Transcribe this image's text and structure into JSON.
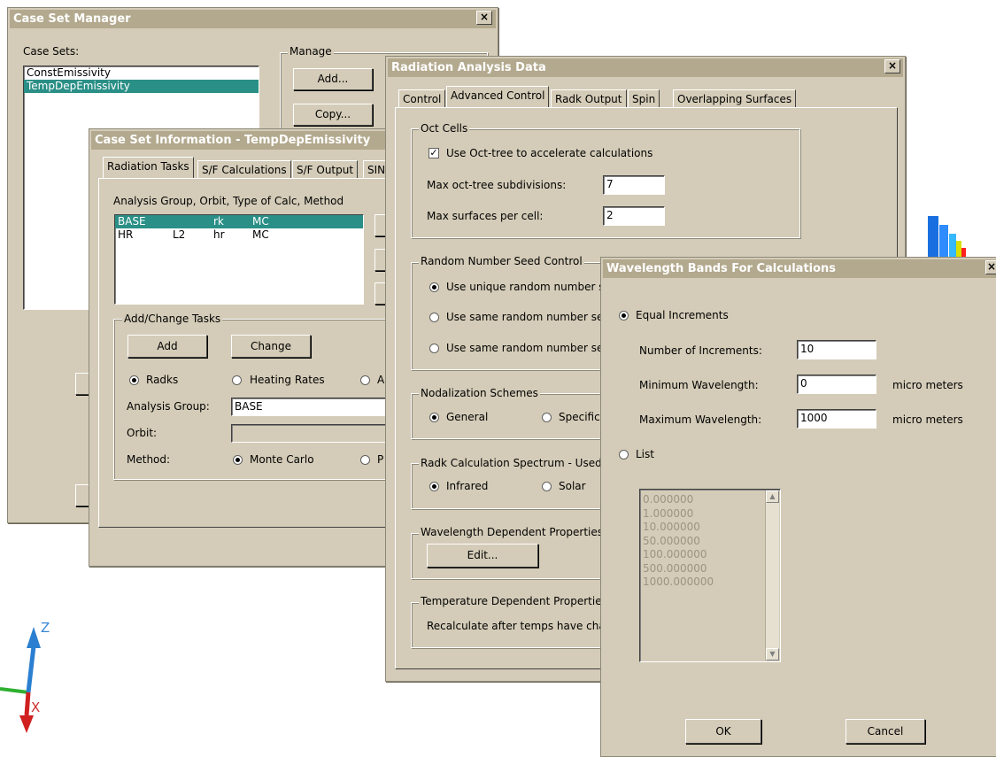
{
  "case_set_manager": {
    "title": "Case Set Manager",
    "close": "×",
    "case_sets_label": "Case Sets:",
    "case_sets": [
      "ConstEmissivity",
      "TempDepEmissivity"
    ],
    "selected_index": 1,
    "manage_label": "Manage",
    "add_button": "Add...",
    "copy_button": "Copy..."
  },
  "case_set_info": {
    "title": "Case Set Information - TempDepEmissivity",
    "tabs": [
      "Radiation Tasks",
      "S/F Calculations",
      "S/F Output",
      "SIN"
    ],
    "list_header": "Analysis Group, Orbit, Type of Calc, Method",
    "rows": [
      {
        "group": "BASE",
        "orbit": "",
        "calc": "rk",
        "method": "MC"
      },
      {
        "group": "HR",
        "orbit": "L2",
        "calc": "hr",
        "method": "MC"
      }
    ],
    "add_change_label": "Add/Change Tasks",
    "add_button": "Add",
    "change_button": "Change",
    "radio_radks": "Radks",
    "radio_heating": "Heating Rates",
    "radio_a": "A",
    "analysis_group_label": "Analysis Group:",
    "analysis_group_value": "BASE",
    "orbit_label": "Orbit:",
    "method_label": "Method:",
    "method_monte_carlo": "Monte Carlo",
    "method_p": "P"
  },
  "radiation_analysis": {
    "title": "Radiation Analysis Data",
    "close": "×",
    "tabs": [
      "Control",
      "Advanced Control",
      "Radk Output",
      "Spin",
      "Overlapping Surfaces"
    ],
    "oct_cells_label": "Oct Cells",
    "use_octtree": "Use Oct-tree to accelerate calculations",
    "max_subdiv_label": "Max oct-tree subdivisions:",
    "max_subdiv_value": "7",
    "max_surf_label": "Max surfaces per cell:",
    "max_surf_value": "2",
    "seed_label": "Random Number Seed Control",
    "seed_opt1": "Use unique random number se",
    "seed_opt2": "Use same random number seec",
    "seed_opt3": "Use same random number seec",
    "nodal_label": "Nodalization Schemes",
    "nodal_general": "General",
    "nodal_specific": "Specific",
    "spectrum_label": "Radk Calculation Spectrum - Used f",
    "spectrum_infrared": "Infrared",
    "spectrum_solar": "Solar",
    "wavelength_label": "Wavelength Dependent Properties",
    "edit_button": "Edit...",
    "temp_label": "Temperature Dependent Properties",
    "temp_text": "Recalculate after temps have chan"
  },
  "wavelength_bands": {
    "title": "Wavelength Bands For Calculations",
    "close": "×",
    "equal_increments": "Equal Increments",
    "num_inc_label": "Number of Increments:",
    "num_inc_value": "10",
    "min_wl_label": "Minimum Wavelength:",
    "min_wl_value": "0",
    "max_wl_label": "Maximum Wavelength:",
    "max_wl_value": "1000",
    "unit": "micro meters",
    "list_label": "List",
    "list_values": [
      "0.000000",
      "1.000000",
      "10.000000",
      "50.000000",
      "100.000000",
      "500.000000",
      "1000.000000"
    ],
    "ok_button": "OK",
    "cancel_button": "Cancel"
  },
  "axes": {
    "z_label": "Z",
    "x_label": "X"
  }
}
